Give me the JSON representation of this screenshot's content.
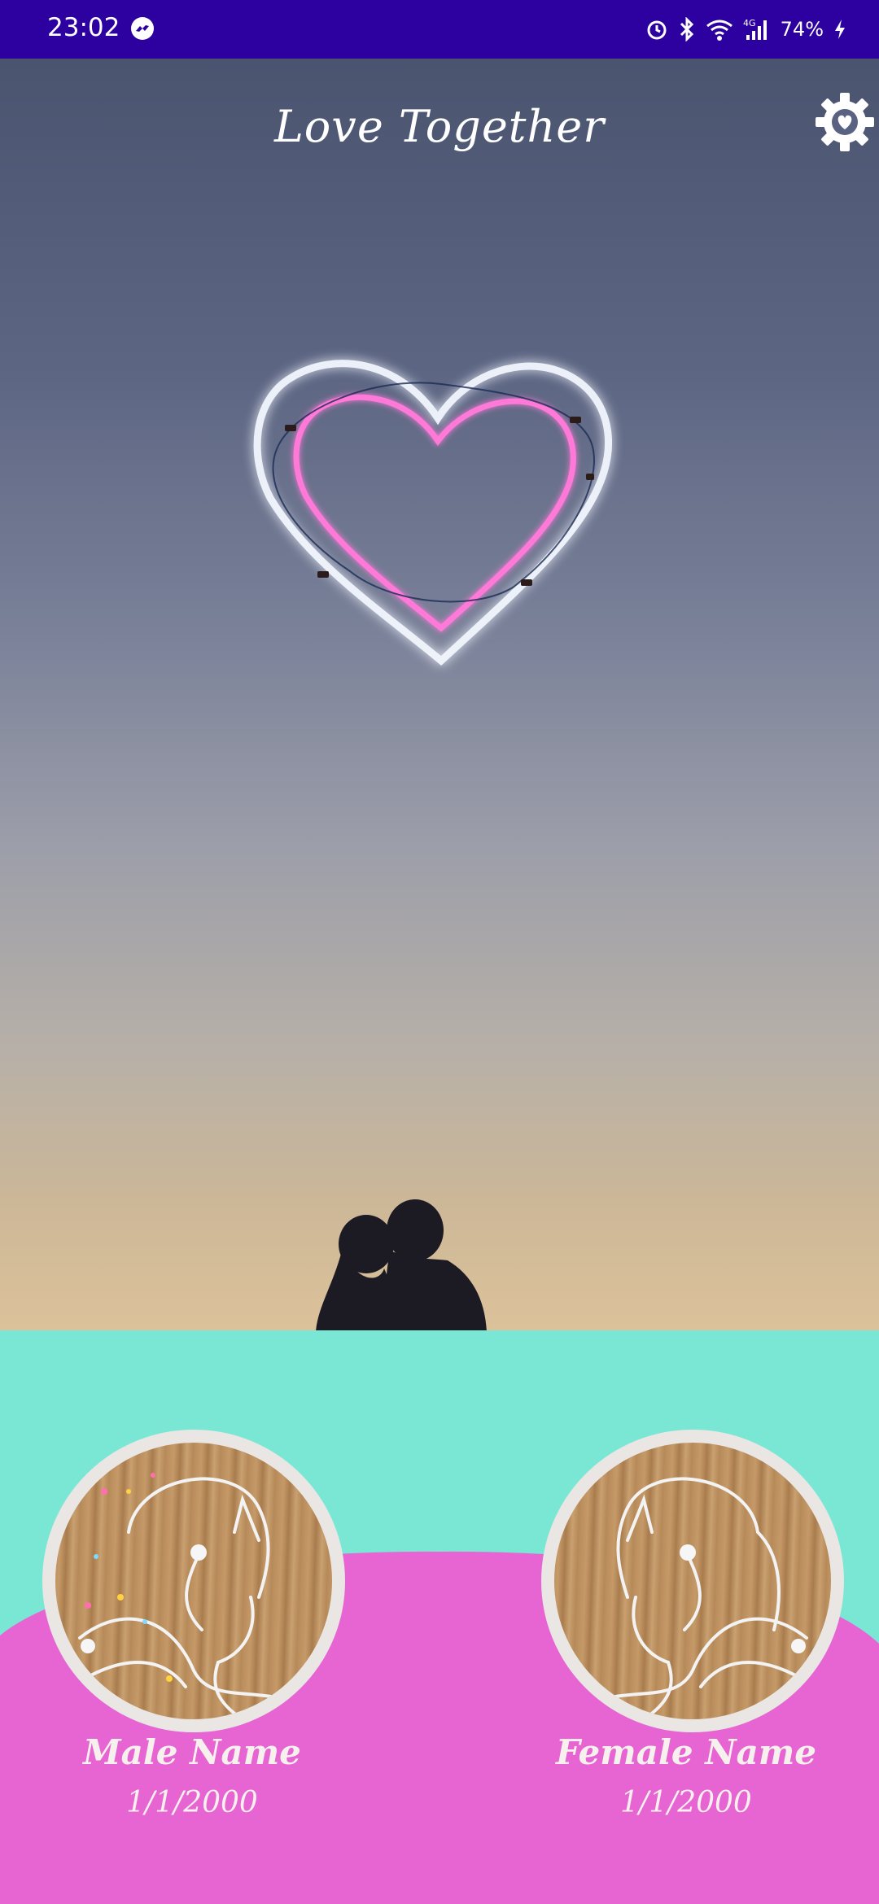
{
  "status_bar": {
    "time": "23:02",
    "battery": "74%",
    "icons": [
      "messenger-icon",
      "alarm-icon",
      "bluetooth-icon",
      "wifi-icon",
      "signal-4g-icon",
      "charging-icon"
    ]
  },
  "header": {
    "title": "Love Together",
    "settings_icon": "gear-heart-icon"
  },
  "hero": {
    "heart_icon": "neon-heart",
    "image": "couple-silhouette"
  },
  "profiles": {
    "male": {
      "name": "Male Name",
      "date": "1/1/2000"
    },
    "female": {
      "name": "Female Name",
      "date": "1/1/2000"
    }
  },
  "colors": {
    "status_bar": "#2d00a0",
    "teal": "#7ae6d4",
    "pink": "#e765d2",
    "neon_pink": "#ff7ad8",
    "neon_white": "#f4f8ff"
  }
}
